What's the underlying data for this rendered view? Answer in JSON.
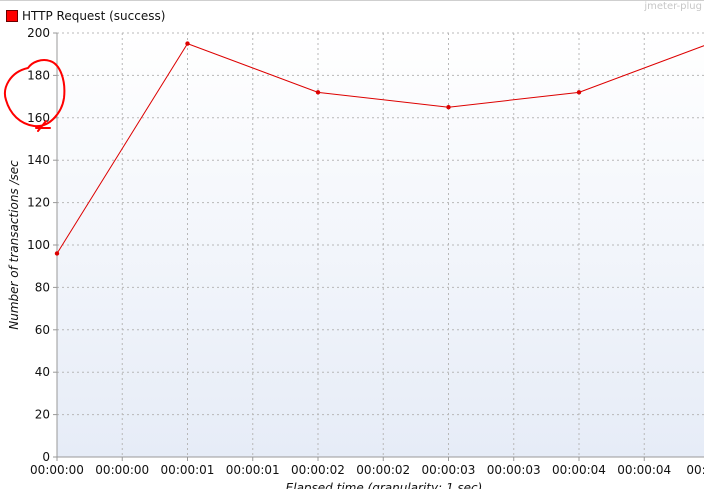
{
  "legend": {
    "label": "HTTP Request (success)",
    "color": "#ff0000"
  },
  "watermark": "jmeter-plug",
  "chart_data": {
    "type": "line",
    "xlabel": "Elapsed time (granularity: 1 sec)",
    "ylabel": "Number of transactions /sec",
    "ylim": [
      0,
      200
    ],
    "y_ticks": [
      "0",
      "20",
      "40",
      "60",
      "80",
      "100",
      "120",
      "140",
      "160",
      "180",
      "200"
    ],
    "x_ticks": [
      "00:00:00",
      "00:00:00",
      "00:00:01",
      "00:00:01",
      "00:00:02",
      "00:00:02",
      "00:00:03",
      "00:00:03",
      "00:00:04",
      "00:00:04",
      "00:00:0"
    ],
    "x_tick_seconds": [
      0,
      0.5,
      1,
      1.5,
      2,
      2.5,
      3,
      3.5,
      4,
      4.5,
      5
    ],
    "grid": true,
    "legend_position": "top-left",
    "series": [
      {
        "name": "HTTP Request (success)",
        "color": "#dd0000",
        "x": [
          0,
          1,
          2,
          3,
          4,
          5
        ],
        "values": [
          96,
          195,
          172,
          165,
          172,
          195
        ]
      }
    ]
  },
  "annotation": {
    "type": "hand-drawn-circle",
    "color": "#ff0000",
    "target": "y-axis labels 160-180"
  }
}
